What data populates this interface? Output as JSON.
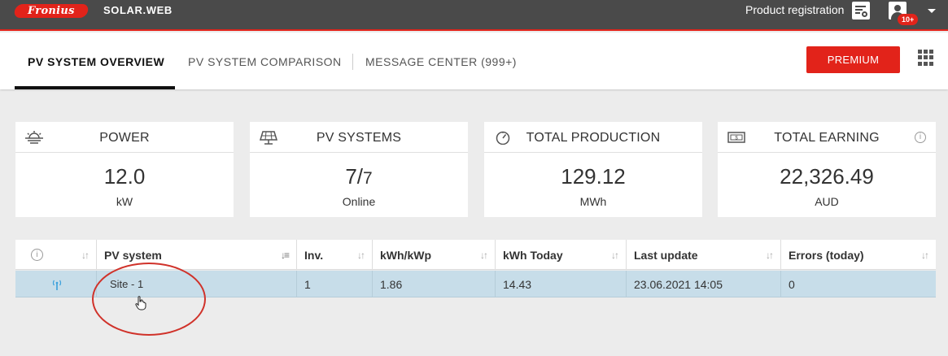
{
  "topbar": {
    "logo_text": "Fronius",
    "app_name": "SOLAR.WEB",
    "product_registration": "Product registration",
    "notification_badge": "10+",
    "icons": [
      "certificate-icon",
      "user-icon",
      "caret-down-icon"
    ]
  },
  "nav": {
    "tabs": [
      {
        "label": "PV SYSTEM OVERVIEW",
        "active": true
      },
      {
        "label": "PV SYSTEM COMPARISON",
        "active": false
      },
      {
        "label": "MESSAGE CENTER (999+)",
        "active": false
      }
    ],
    "premium_label": "PREMIUM",
    "apps_icon": "apps-grid-icon"
  },
  "cards": [
    {
      "title": "POWER",
      "value": "12.0",
      "unit": "kW",
      "icon": "sun-icon"
    },
    {
      "title": "PV SYSTEMS",
      "value_main": "7/",
      "value_small": "7",
      "unit": "Online",
      "icon": "solar-panel-icon"
    },
    {
      "title": "TOTAL PRODUCTION",
      "value": "129.12",
      "unit": "MWh",
      "icon": "gauge-icon"
    },
    {
      "title": "TOTAL EARNING",
      "value": "22,326.49",
      "unit": "AUD",
      "icon": "money-icon",
      "info": "i"
    }
  ],
  "table": {
    "info_symbol": "i",
    "columns": [
      "PV system",
      "Inv.",
      "kWh/kWp",
      "kWh Today",
      "Last update",
      "Errors (today)"
    ],
    "rows": [
      {
        "system": "Site - 1",
        "inv": "1",
        "kwh_kwp": "1.86",
        "kwh_today": "14.43",
        "last_update": "23.06.2021 14:05",
        "errors": "0"
      }
    ]
  },
  "colors": {
    "brand_red": "#e2231a",
    "topbar": "#4a4a4a",
    "row_highlight": "#c7dde9",
    "status_icon": "#3aa0dc"
  }
}
